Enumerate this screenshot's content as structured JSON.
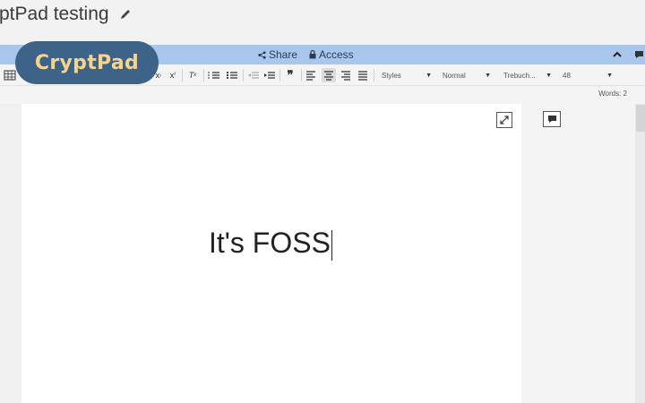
{
  "title_bar": {
    "title": "ptPad testing"
  },
  "logo": {
    "text": "CryptPad"
  },
  "top_bar": {
    "share_label": "Share",
    "access_label": "Access"
  },
  "toolbar": {
    "styles_value": "Styles",
    "format_value": "Normal",
    "font_value": "Trebuch...",
    "size_value": "48"
  },
  "status": {
    "word_count": "Words: 2"
  },
  "document": {
    "text": "It's FOSS"
  },
  "colors": {
    "accent_bar": "#a9c7ec",
    "logo_bg": "#3d6388",
    "logo_text": "#f6d48b"
  }
}
